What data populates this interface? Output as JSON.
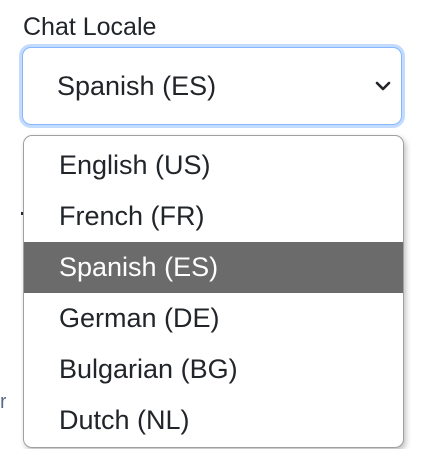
{
  "field": {
    "label": "Chat Locale",
    "selected_value": "Spanish (ES)"
  },
  "dropdown": {
    "options": [
      {
        "label": "English (US)",
        "selected": false
      },
      {
        "label": "French (FR)",
        "selected": false
      },
      {
        "label": "Spanish (ES)",
        "selected": true
      },
      {
        "label": "German (DE)",
        "selected": false
      },
      {
        "label": "Bulgarian (BG)",
        "selected": false
      },
      {
        "label": "Dutch (NL)",
        "selected": false
      }
    ]
  },
  "icons": {
    "select_arrow": "chevron-down-icon"
  },
  "colors": {
    "focus_border": "#86b7fe",
    "highlight": "#6b6b6b",
    "text": "#212529"
  }
}
